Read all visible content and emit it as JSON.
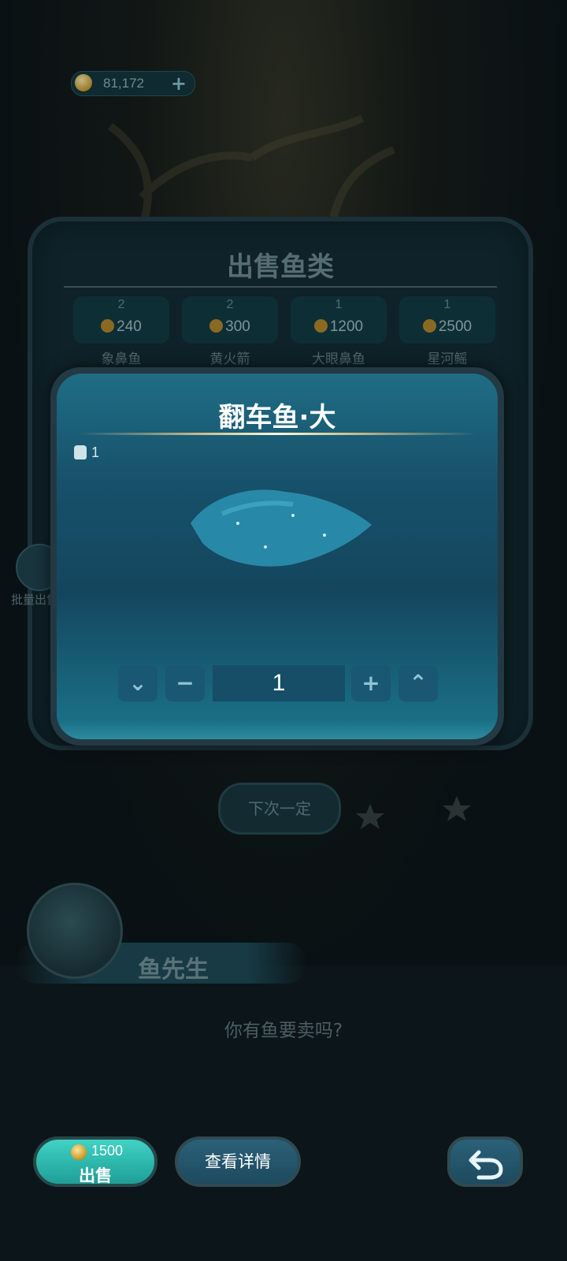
{
  "currency": {
    "coins": "81,172",
    "plus_icon": "plus-icon"
  },
  "sell_panel": {
    "title": "出售鱼类",
    "fish": [
      {
        "count": "2",
        "price": "240",
        "name": "象鼻鱼"
      },
      {
        "count": "2",
        "price": "300",
        "name": "黄火箭"
      },
      {
        "count": "1",
        "price": "1200",
        "name": "大眼鼻鱼"
      },
      {
        "count": "1",
        "price": "2500",
        "name": "星河鳐"
      }
    ],
    "batch_label": "批量出售"
  },
  "modal": {
    "title": "翻车鱼·大",
    "owned": "1",
    "quantity": "1",
    "buttons": {
      "min": "⌄",
      "minus": "−",
      "plus": "+",
      "max": "⌃"
    }
  },
  "next_button": "下次一定",
  "dialogue": {
    "speaker": "鱼先生",
    "text": "你有鱼要卖吗?"
  },
  "bottom": {
    "sell_price": "1500",
    "sell_label": "出售",
    "detail_label": "查看详情"
  },
  "colors": {
    "sell_accent": "#2fbfb4",
    "panel_blue": "#1a5a72"
  }
}
